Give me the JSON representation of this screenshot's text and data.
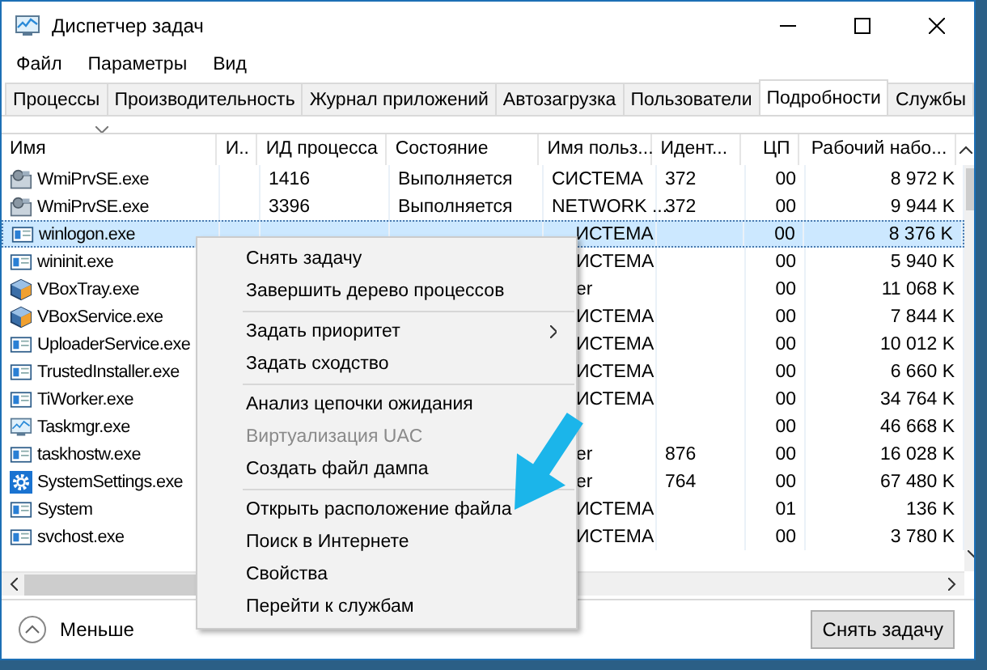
{
  "window": {
    "title": "Диспетчер задач"
  },
  "menu": [
    "Файл",
    "Параметры",
    "Вид"
  ],
  "tabs": [
    {
      "label": "Процессы",
      "selected": false
    },
    {
      "label": "Производительность",
      "selected": false
    },
    {
      "label": "Журнал приложений",
      "selected": false
    },
    {
      "label": "Автозагрузка",
      "selected": false
    },
    {
      "label": "Пользователи",
      "selected": false
    },
    {
      "label": "Подробности",
      "selected": true
    },
    {
      "label": "Службы",
      "selected": false
    }
  ],
  "table": {
    "columns": [
      "Имя",
      "И..",
      "ИД процесса",
      "Состояние",
      "Имя польз...",
      "Идент...",
      "ЦП",
      "Рабочий набо..."
    ],
    "rows": [
      {
        "kind": "service",
        "selected": false,
        "name": "WmiPrvSE.exe",
        "pid": "1416",
        "status": "Выполняется",
        "user": "СИСТЕМА",
        "ident": "372",
        "cpu": "00",
        "memory": "8 972 K"
      },
      {
        "kind": "service",
        "selected": false,
        "name": "WmiPrvSE.exe",
        "pid": "3396",
        "status": "Выполняется",
        "user": "NETWORK ...",
        "ident": "372",
        "cpu": "00",
        "memory": "9 944 K"
      },
      {
        "kind": "app",
        "selected": true,
        "name": "winlogon.exe",
        "user": "ИСТЕМА",
        "cpu": "00",
        "memory": "8 376 K"
      },
      {
        "kind": "app",
        "selected": false,
        "name": "wininit.exe",
        "user": "ИСТЕМА",
        "cpu": "00",
        "memory": "5 940 K"
      },
      {
        "kind": "box",
        "selected": false,
        "name": "VBoxTray.exe",
        "user": "er",
        "cpu": "00",
        "memory": "11 068 K"
      },
      {
        "kind": "box",
        "selected": false,
        "name": "VBoxService.exe",
        "user": "ИСТЕМА",
        "cpu": "00",
        "memory": "7 844 K"
      },
      {
        "kind": "app",
        "selected": false,
        "name": "UploaderService.exe",
        "user": "ИСТЕМА",
        "cpu": "00",
        "memory": "10 012 K"
      },
      {
        "kind": "app",
        "selected": false,
        "name": "TrustedInstaller.exe",
        "user": "ИСТЕМА",
        "cpu": "00",
        "memory": "6 660 K"
      },
      {
        "kind": "app",
        "selected": false,
        "name": "TiWorker.exe",
        "user": "ИСТЕМА",
        "cpu": "00",
        "memory": "34 764 K"
      },
      {
        "kind": "monitor",
        "selected": false,
        "name": "Taskmgr.exe",
        "cpu": "00",
        "memory": "46 668 K"
      },
      {
        "kind": "app",
        "selected": false,
        "name": "taskhostw.exe",
        "user": "er",
        "ident": "876",
        "cpu": "00",
        "memory": "16 028 K"
      },
      {
        "kind": "settings",
        "selected": false,
        "name": "SystemSettings.exe",
        "user": "er",
        "ident": "764",
        "cpu": "00",
        "memory": "67 480 K"
      },
      {
        "kind": "app",
        "selected": false,
        "name": "System",
        "user": "ИСТЕМА",
        "cpu": "01",
        "memory": "136 K"
      },
      {
        "kind": "app",
        "selected": false,
        "name": "svchost.exe",
        "user": "ИСТЕМА",
        "cpu": "00",
        "memory": "3 780 K"
      }
    ]
  },
  "context_menu": [
    {
      "kind": "item",
      "label": "Снять задачу",
      "disabled": false,
      "submenu": false
    },
    {
      "kind": "item",
      "label": "Завершить дерево процессов",
      "disabled": false,
      "submenu": false
    },
    {
      "kind": "separator"
    },
    {
      "kind": "item",
      "label": "Задать приоритет",
      "disabled": false,
      "submenu": true
    },
    {
      "kind": "item",
      "label": "Задать сходство",
      "disabled": false,
      "submenu": false
    },
    {
      "kind": "separator"
    },
    {
      "kind": "item",
      "label": "Анализ цепочки ожидания",
      "disabled": false,
      "submenu": false
    },
    {
      "kind": "item",
      "label": "Виртуализация UAC",
      "disabled": true,
      "submenu": false
    },
    {
      "kind": "item",
      "label": "Создать файл дампа",
      "disabled": false,
      "submenu": false
    },
    {
      "kind": "separator"
    },
    {
      "kind": "item",
      "label": "Открыть расположение файла",
      "disabled": false,
      "submenu": false
    },
    {
      "kind": "item",
      "label": "Поиск в Интернете",
      "disabled": false,
      "submenu": false
    },
    {
      "kind": "item",
      "label": "Свойства",
      "disabled": false,
      "submenu": false
    },
    {
      "kind": "item",
      "label": "Перейти к службам",
      "disabled": false,
      "submenu": false
    }
  ],
  "footer": {
    "less": "Меньше",
    "end_task": "Снять задачу"
  }
}
